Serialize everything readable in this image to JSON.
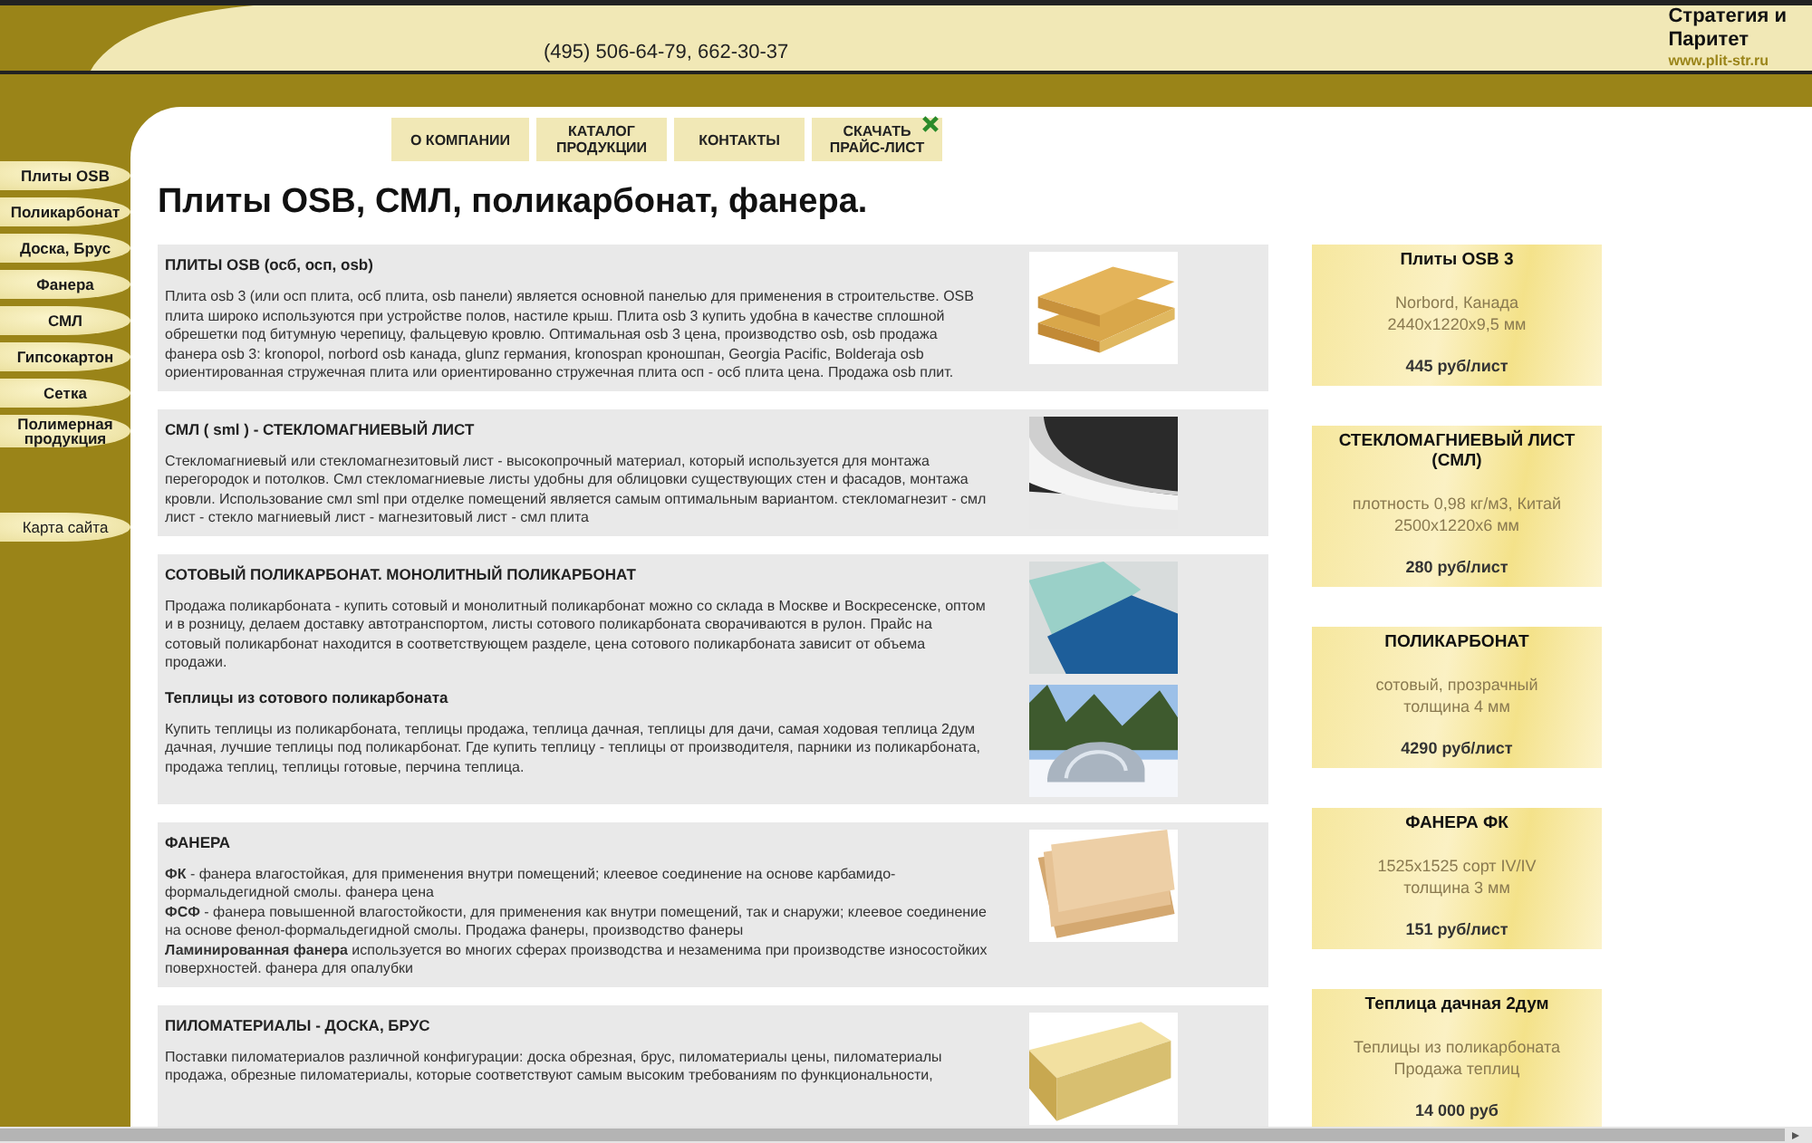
{
  "header": {
    "phone": "(495) 506-64-79, 662-30-37",
    "logo": {
      "name_line_1": "Стратегия и",
      "name_line_2": "Паритет",
      "url": "www.plit-str.ru"
    }
  },
  "nav": [
    {
      "label": "О КОМПАНИИ",
      "kind": "link"
    },
    {
      "label": "КАТАЛОГ ПРОДУКЦИИ",
      "kind": "link"
    },
    {
      "label": "КОНТАКТЫ",
      "kind": "link"
    },
    {
      "label": "СКАЧАТЬ ПРАЙС-ЛИСТ",
      "kind": "download"
    }
  ],
  "sidebar": {
    "items": [
      {
        "label": "Плиты OSB"
      },
      {
        "label": "Поликарбонат"
      },
      {
        "label": "Доска, Брус"
      },
      {
        "label": "Фанера"
      },
      {
        "label": "СМЛ"
      },
      {
        "label": "Гипсокартон"
      },
      {
        "label": "Сетка"
      },
      {
        "label": "Полимерная продукция"
      }
    ],
    "sitemap": "Карта сайта"
  },
  "page_title": "Плиты OSB, СМЛ, поликарбонат, фанера.",
  "sections": [
    {
      "blocks": [
        {
          "title": "ПЛИТЫ OSB (осб, осп, osb)",
          "lines": [
            "Плита osb 3 (или осп плита, осб плита, osb панели) является основной панелью для применения в строительстве. OSB плита широко используются при устройстве полов, настиле крыш. Плита osb 3 купить удобна в качестве сплошной обрешетки под битумную черепицу, фальцевую кровлю. Оптимальная osb 3 цена, производство osb, osb продажа фанера osb 3: kronopol, norbord osb канада, glunz германия, kronospan кроношпан, Georgia Pacific, Bolderaja osb ориентированная стружечная плита или ориентированно стружечная плита осп - осб плита цена. Продажа osb плит."
          ]
        }
      ]
    },
    {
      "blocks": [
        {
          "title": "СМЛ ( sml ) - СТЕКЛОМАГНИЕВЫЙ ЛИСТ",
          "lines": [
            "Стекломагниевый или стекломагнезитовый лист - высокопрочный материал, который используется для монтажа перегородок и потолков. Смл стекломагниевые листы удобны для облицовки существующих стен и фасадов, монтажа кровли. Использование смл sml при отделке помещений является самым оптимальным вариантом. стекломагнезит - смл лист - стекло магниевый лист - магнезитовый лист - смл плита"
          ]
        }
      ]
    },
    {
      "blocks": [
        {
          "title": "СОТОВЫЙ ПОЛИКАРБОНАТ. МОНОЛИТНЫЙ ПОЛИКАРБОНАТ",
          "lines": [
            "Продажа поликарбоната - купить сотовый и монолитный поликарбонат можно со склада в Москве и Воскресенске, оптом и в розницу, делаем доставку автотранспортом, листы сотового поликарбоната сворачиваются в рулон. Прайс на сотовый поликарбонат находится в соответствующем разделе, цена сотового поликарбоната зависит от объема продажи."
          ]
        },
        {
          "title": "Теплицы из сотового поликарбоната",
          "lines": [
            "Купить теплицы из поликарбоната, теплицы продажа, теплица дачная, теплицы для дачи, самая ходовая теплица 2дум дачная, лучшие теплицы под поликарбонат. Где купить теплицу - теплицы от производителя, парники из поликарбоната, продажа теплиц, теплицы готовые, перчина теплица."
          ]
        }
      ]
    },
    {
      "blocks": [
        {
          "title": "ФАНЕРА",
          "lines": [
            "**ФК** - фанера влагостойкая, для применения внутри помещений; клеевое соединение на основе карбамидо-формальдегидной смолы. фанера цена",
            "**ФСФ** - фанера повышенной влагостойкости, для применения как внутри помещений, так и снаружи; клеевое соединение на основе фенол-формальдегидной смолы. Продажа фанеры, производство фанеры",
            "**Ламинированная фанера** используется во многих сферах производства и незаменима при производстве износостойких поверхностей. фанера для опалубки"
          ]
        }
      ]
    },
    {
      "blocks": [
        {
          "title": "ПИЛОМАТЕРИАЛЫ - ДОСКА, БРУС",
          "lines": [
            "Поставки пиломатериалов различной конфигурации: доска обрезная, брус, пиломатериалы цены, пиломатериалы продажа, обрезные пиломатериалы, которые соответствуют самым высоким требованиям по функциональности,"
          ]
        }
      ]
    }
  ],
  "offers": [
    {
      "title": "Плиты OSB 3",
      "details": [
        "Norbord, Канада",
        "2440x1220x9,5 мм"
      ],
      "price": "445 руб/лист"
    },
    {
      "title": "СТЕКЛОМАГНИЕВЫЙ ЛИСТ (СМЛ)",
      "details": [
        "плотность 0,98 кг/м3, Китай",
        "2500x1220x6 мм"
      ],
      "price": "280 руб/лист"
    },
    {
      "title": "ПОЛИКАРБОНАТ",
      "details": [
        "сотовый, прозрачный",
        "толщина 4 мм"
      ],
      "price": "4290 руб/лист"
    },
    {
      "title": "ФАНЕРА ФК",
      "details": [
        "1525x1525 сорт IV/IV",
        "толщина 3 мм"
      ],
      "price": "151 руб/лист"
    },
    {
      "title": "Теплица дачная 2дум",
      "details": [
        "Теплицы из поликарбоната",
        "Продажа теплиц"
      ],
      "price": "14 000 руб"
    }
  ]
}
